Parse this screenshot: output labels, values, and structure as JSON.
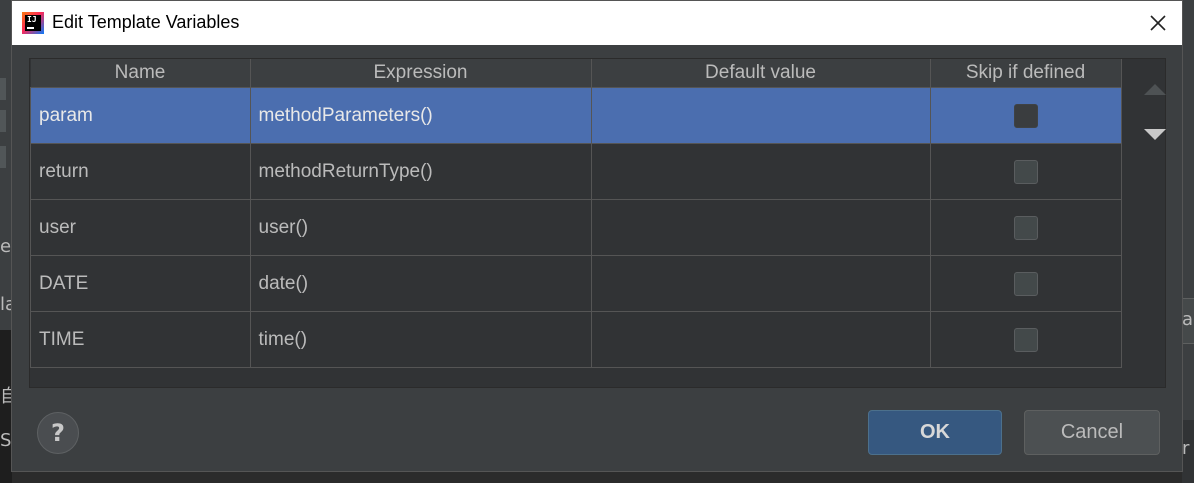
{
  "dialog": {
    "title": "Edit Template Variables"
  },
  "table": {
    "headers": [
      "Name",
      "Expression",
      "Default value",
      "Skip if defined"
    ],
    "rows": [
      {
        "name": "param",
        "expression": "methodParameters()",
        "default_value": "",
        "skip_if_defined": false,
        "selected": true
      },
      {
        "name": "return",
        "expression": "methodReturnType()",
        "default_value": "",
        "skip_if_defined": false,
        "selected": false
      },
      {
        "name": "user",
        "expression": "user()",
        "default_value": "",
        "skip_if_defined": false,
        "selected": false
      },
      {
        "name": "DATE",
        "expression": "date()",
        "default_value": "",
        "skip_if_defined": false,
        "selected": false
      },
      {
        "name": "TIME",
        "expression": "time()",
        "default_value": "",
        "skip_if_defined": false,
        "selected": false
      }
    ]
  },
  "buttons": {
    "help_label": "?",
    "ok_label": "OK",
    "cancel_label": "Cancel"
  },
  "icons": {
    "app": "intellij-idea-icon",
    "close": "close-icon",
    "move_up": "triangle-up-icon",
    "move_down": "triangle-down-icon"
  },
  "colors": {
    "selection": "#4b6eaf",
    "ok_button": "#365880",
    "dialog_bg": "#3c3f41"
  },
  "background": {
    "left_fragments": [
      "ev",
      "la",
      "自",
      "S"
    ],
    "right_fragments": [
      "ab",
      "r"
    ]
  }
}
